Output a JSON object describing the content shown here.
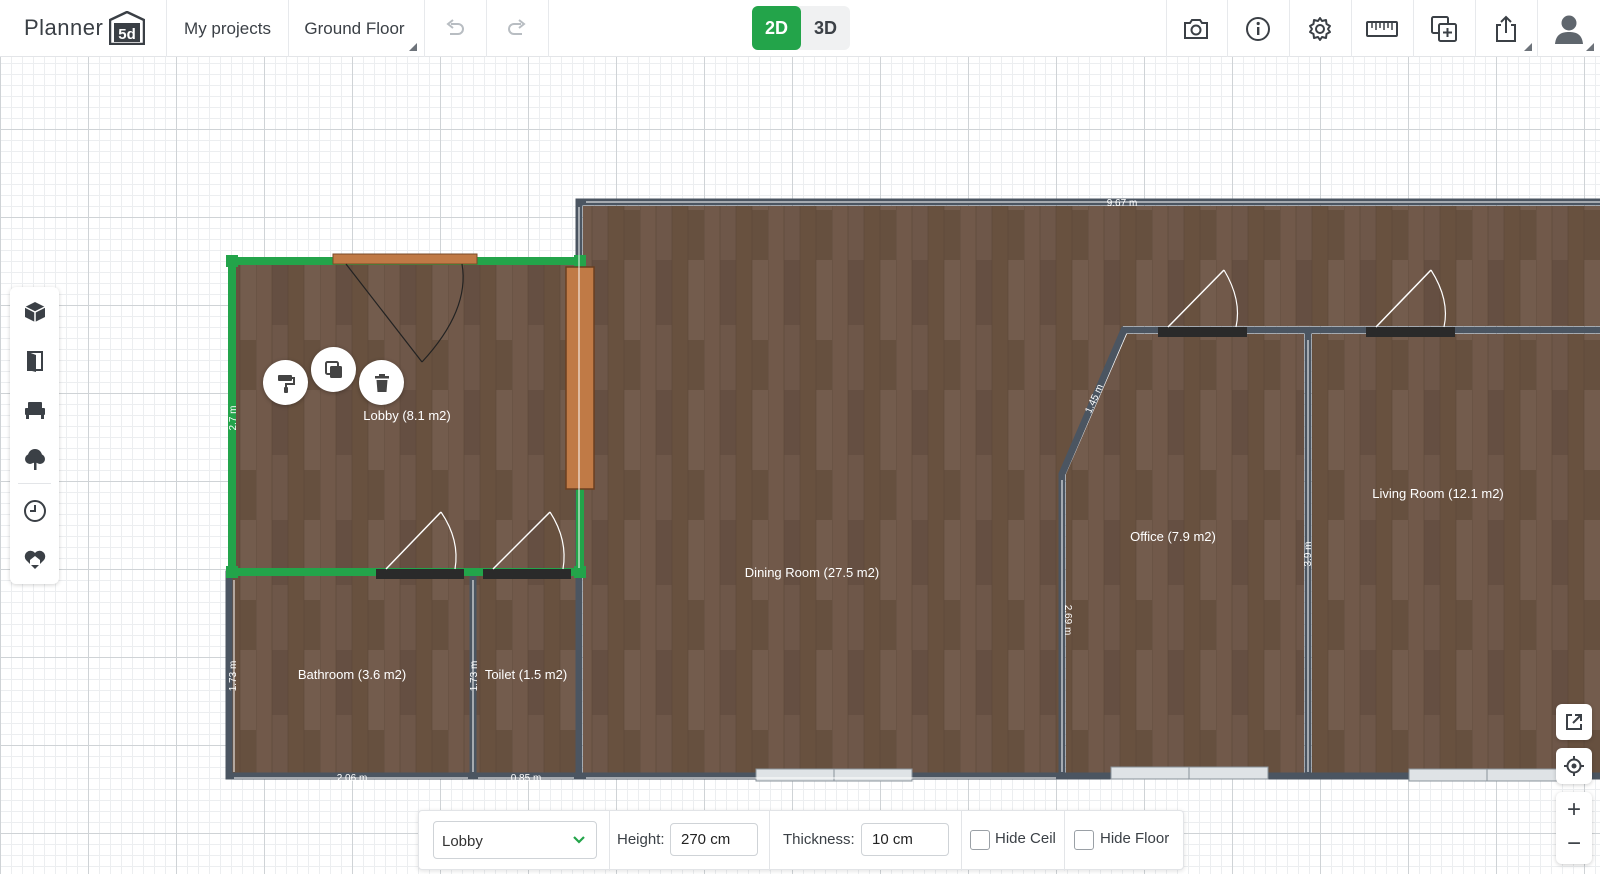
{
  "app": {
    "logo_text": "Planner",
    "logo_badge": "5d"
  },
  "header": {
    "my_projects": "My projects",
    "floor": "Ground Floor",
    "view_2d": "2D",
    "view_3d": "3D"
  },
  "left_toolbar": [
    {
      "name": "construction-icon"
    },
    {
      "name": "doors-icon"
    },
    {
      "name": "furniture-icon"
    },
    {
      "name": "exterior-icon"
    },
    {
      "name": "history-icon"
    },
    {
      "name": "favorites-icon"
    }
  ],
  "right_header_icons": [
    "camera-icon",
    "info-icon",
    "settings-icon",
    "ruler-icon",
    "add-floor-icon",
    "share-icon",
    "user-icon"
  ],
  "rooms": {
    "lobby": "Lobby (8.1 m2)",
    "dining": "Dining Room (27.5 m2)",
    "office": "Office (7.9 m2)",
    "living": "Living Room (12.1 m2)",
    "bathroom": "Bathroom (3.6 m2)",
    "toilet": "Toilet (1.5 m2)"
  },
  "dimensions": {
    "top": "9.67 m",
    "lobby_left": "2.7 m",
    "bathroom_left": "1.73 m",
    "toilet_left": "1.73 m",
    "bath_bottom": "2.06 m",
    "toilet_bottom": "0.85 m",
    "diag": "1.45 m",
    "office_left": "2.69 m",
    "living_left": "3.9 m"
  },
  "bottom_panel": {
    "room_value": "Lobby",
    "height_label": "Height:",
    "height_value": "270 cm",
    "thickness_label": "Thickness:",
    "thickness_value": "10 cm",
    "hide_ceil": "Hide Ceil",
    "hide_floor": "Hide Floor"
  },
  "zoom": {
    "in": "+",
    "out": "−"
  },
  "colors": {
    "accent": "#23a44a",
    "wall": "#4b5561",
    "floor": "#6a5446",
    "door_wood": "#c07a46"
  }
}
